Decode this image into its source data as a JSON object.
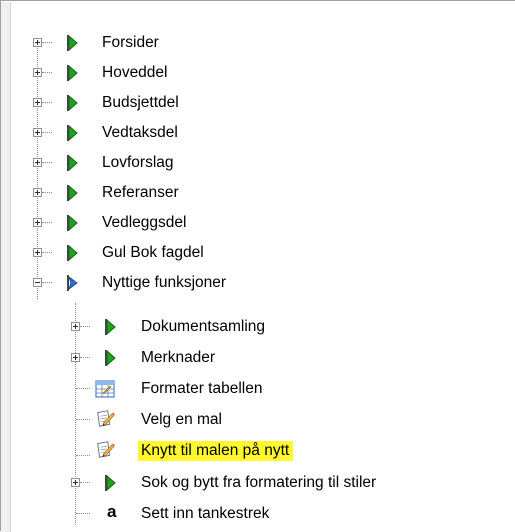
{
  "tree": {
    "items": [
      {
        "label": "Forsider",
        "icon": "green-arrow-icon",
        "expander": "plus"
      },
      {
        "label": "Hoveddel",
        "icon": "green-arrow-icon",
        "expander": "plus"
      },
      {
        "label": "Budsjettdel",
        "icon": "green-arrow-icon",
        "expander": "plus"
      },
      {
        "label": "Vedtaksdel",
        "icon": "green-arrow-icon",
        "expander": "plus"
      },
      {
        "label": "Lovforslag",
        "icon": "green-arrow-icon",
        "expander": "plus"
      },
      {
        "label": "Referanser",
        "icon": "green-arrow-icon",
        "expander": "plus"
      },
      {
        "label": "Vedleggsdel",
        "icon": "green-arrow-icon",
        "expander": "plus"
      },
      {
        "label": "Gul Bok fagdel",
        "icon": "green-arrow-icon",
        "expander": "plus"
      },
      {
        "label": "Nyttige funksjoner",
        "icon": "blue-arrow-icon",
        "expander": "minus"
      }
    ],
    "children": [
      {
        "label": "Dokumentsamling",
        "icon": "green-arrow-icon",
        "expander": "plus"
      },
      {
        "label": "Merknader",
        "icon": "green-arrow-icon",
        "expander": "plus"
      },
      {
        "label": "Formater tabellen",
        "icon": "format-table-icon",
        "expander": "none"
      },
      {
        "label": "Velg en mal",
        "icon": "template-pencil-icon",
        "expander": "none"
      },
      {
        "label": "Knytt til malen på nytt",
        "icon": "template-pencil-icon",
        "expander": "none",
        "highlighted": true
      },
      {
        "label": "Sok og bytt fra formatering til stiler",
        "icon": "green-arrow-icon",
        "expander": "plus"
      },
      {
        "label": "Sett inn tankestrek",
        "icon": "letter-a-icon",
        "expander": "none",
        "icon_text": "a"
      }
    ]
  },
  "colors": {
    "highlight": "#fff82f",
    "flag_green": "#1fa21f",
    "flag_blue": "#2a6fd8"
  }
}
